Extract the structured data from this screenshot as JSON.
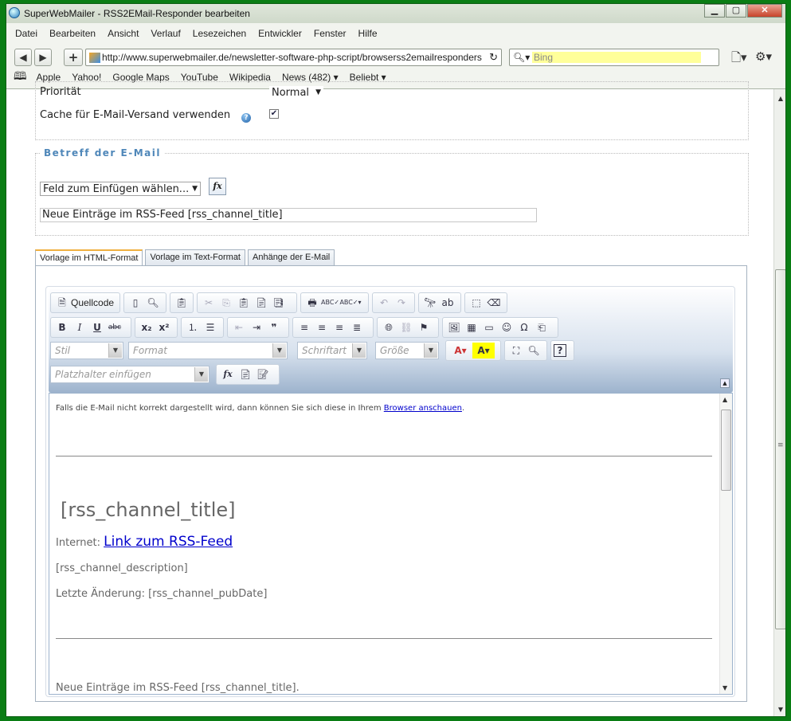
{
  "window": {
    "title": "SuperWebMailer - RSS2EMail-Responder bearbeiten",
    "min": "▁",
    "max": "▢",
    "close": "✕"
  },
  "menu": [
    "Datei",
    "Bearbeiten",
    "Ansicht",
    "Verlauf",
    "Lesezeichen",
    "Entwickler",
    "Fenster",
    "Hilfe"
  ],
  "nav": {
    "back": "◀",
    "forward": "▶",
    "add": "+",
    "url": "http://www.superwebmailer.de/newsletter-software-php-script/browserss2emailresponders",
    "reload": "↻",
    "search_placeholder": "Bing",
    "page_icon": "page-menu-icon",
    "gear_icon": "gear-icon"
  },
  "bookmarks": [
    "Apple",
    "Yahoo!",
    "Google Maps",
    "YouTube",
    "Wikipedia",
    "News (482) ▾",
    "Beliebt ▾"
  ],
  "form": {
    "prioritaet_label": "Priorität",
    "prioritaet_value": "Normal",
    "cache_label": "Cache für E-Mail-Versand verwenden",
    "cache_checked": true,
    "subject_legend": "Betreff der E-Mail",
    "insert_field_select": "Feld zum Einfügen wählen...",
    "fx_label": "fx",
    "subject_value": "Neue Einträge im RSS-Feed [rss_channel_title]"
  },
  "tabs": [
    "Vorlage im HTML-Format",
    "Vorlage im Text-Format",
    "Anhänge der E-Mail"
  ],
  "editor": {
    "source_label": "Quellcode",
    "style_placeholder": "Stil",
    "format_placeholder": "Format",
    "font_placeholder": "Schriftart",
    "size_placeholder": "Größe",
    "placeholder_select": "Platzhalter einfügen",
    "content": {
      "browser_notice_prefix": "Falls die E-Mail nicht korrekt dargestellt wird, dann können Sie sich diese in Ihrem",
      "browser_link": "Browser anschauen",
      "browser_notice_suffix": ".",
      "channel_title": "[rss_channel_title]",
      "internet_label": "Internet:",
      "rss_link": "Link zum RSS-Feed",
      "channel_description": "[rss_channel_description]",
      "last_change": "Letzte Änderung: [rss_channel_pubDate]",
      "new_entries": "Neue Einträge im RSS-Feed [rss_channel_title]."
    }
  },
  "colors": {
    "frame": "#0a7d14",
    "legend": "#4f87b9",
    "link": "#0000cc"
  }
}
